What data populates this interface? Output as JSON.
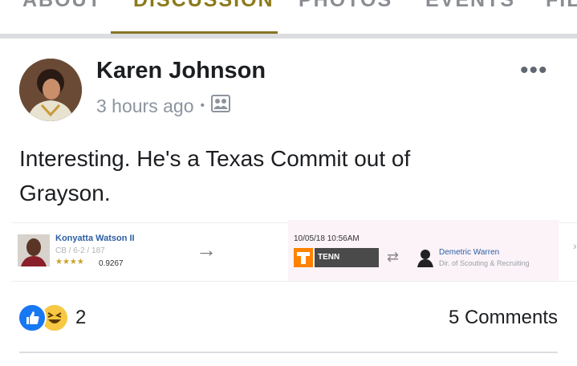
{
  "tabs": [
    {
      "label": "ABOUT",
      "active": false
    },
    {
      "label": "DISCUSSION",
      "active": true
    },
    {
      "label": "PHOTOS",
      "active": false
    },
    {
      "label": "EVENTS",
      "active": false
    },
    {
      "label": "FILES",
      "active": false
    }
  ],
  "post": {
    "author": "Karen Johnson",
    "time": "3 hours ago",
    "privacy_icon": "group-photo-icon",
    "more_label": "•••",
    "text_line1": "Interesting.  He's a Texas Commit out of",
    "text_line2": "Grayson."
  },
  "attachment": {
    "player_name": "Konyatta Watson II",
    "player_pos": "CB / 6-2 / 187",
    "player_stars": "★★★★",
    "player_rating": "0.9267",
    "arrow": "→",
    "date": "10/05/18 10:56AM",
    "team": "TENN",
    "swap": "⇄",
    "scout_name": "Demetric Warren",
    "scout_title": "Dir. of Scouting & Recruiting"
  },
  "reactions": {
    "count": "2",
    "icons": [
      "like-icon",
      "haha-icon"
    ],
    "comments": "5 Comments"
  },
  "colors": {
    "tab_active": "#857426",
    "like_blue": "#1877f2",
    "haha_yellow": "#f7c842",
    "link_blue": "#2d5ea3"
  }
}
